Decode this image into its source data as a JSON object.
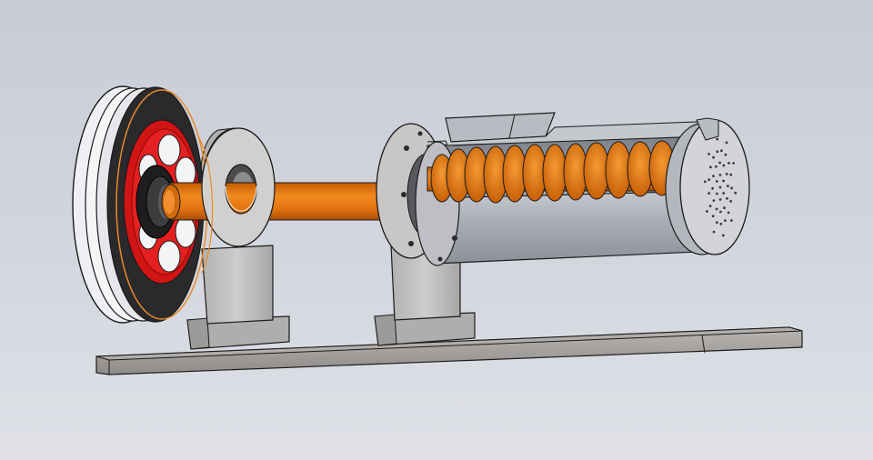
{
  "viewport": {
    "background": "#d3d6de"
  },
  "assembly": {
    "components": [
      {
        "id": "v-belt-pulley",
        "color": "#e9ebef"
      },
      {
        "id": "pulley-hub",
        "color": "#e11b1b"
      },
      {
        "id": "drive-shaft",
        "color": "#e0760f"
      },
      {
        "id": "pillow-block-bearing",
        "color": "#c7c5c3"
      },
      {
        "id": "bearing-support",
        "color": "#c7c5c3"
      },
      {
        "id": "screw-barrel",
        "color": "#a9adb5"
      },
      {
        "id": "feed-hopper",
        "color": "#b3b7be"
      },
      {
        "id": "screw-flights",
        "color": "#e07a14"
      },
      {
        "id": "die-plate",
        "color": "#c9ccd2"
      },
      {
        "id": "base-plate",
        "color": "#9a9794"
      }
    ],
    "die_plate_holes": 46,
    "screw_flight_count": 14
  }
}
